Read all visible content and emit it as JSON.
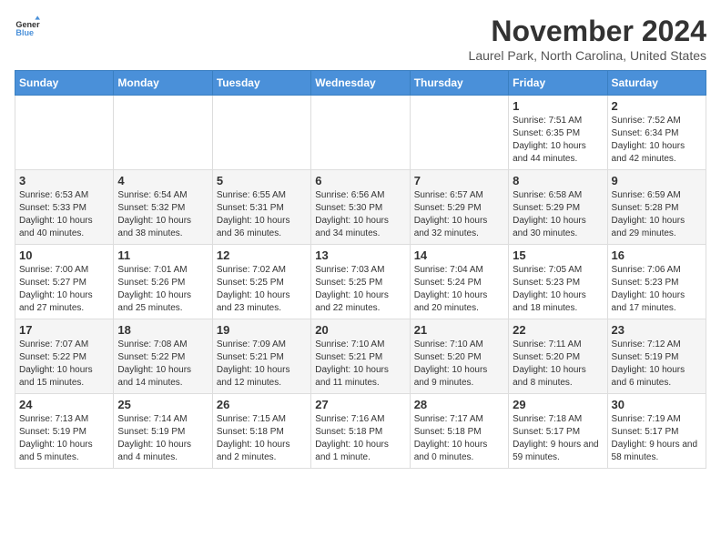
{
  "header": {
    "logo_general": "General",
    "logo_blue": "Blue",
    "month_title": "November 2024",
    "location": "Laurel Park, North Carolina, United States"
  },
  "days_of_week": [
    "Sunday",
    "Monday",
    "Tuesday",
    "Wednesday",
    "Thursday",
    "Friday",
    "Saturday"
  ],
  "weeks": [
    [
      {
        "day": "",
        "info": ""
      },
      {
        "day": "",
        "info": ""
      },
      {
        "day": "",
        "info": ""
      },
      {
        "day": "",
        "info": ""
      },
      {
        "day": "",
        "info": ""
      },
      {
        "day": "1",
        "info": "Sunrise: 7:51 AM\nSunset: 6:35 PM\nDaylight: 10 hours and 44 minutes."
      },
      {
        "day": "2",
        "info": "Sunrise: 7:52 AM\nSunset: 6:34 PM\nDaylight: 10 hours and 42 minutes."
      }
    ],
    [
      {
        "day": "3",
        "info": "Sunrise: 6:53 AM\nSunset: 5:33 PM\nDaylight: 10 hours and 40 minutes."
      },
      {
        "day": "4",
        "info": "Sunrise: 6:54 AM\nSunset: 5:32 PM\nDaylight: 10 hours and 38 minutes."
      },
      {
        "day": "5",
        "info": "Sunrise: 6:55 AM\nSunset: 5:31 PM\nDaylight: 10 hours and 36 minutes."
      },
      {
        "day": "6",
        "info": "Sunrise: 6:56 AM\nSunset: 5:30 PM\nDaylight: 10 hours and 34 minutes."
      },
      {
        "day": "7",
        "info": "Sunrise: 6:57 AM\nSunset: 5:29 PM\nDaylight: 10 hours and 32 minutes."
      },
      {
        "day": "8",
        "info": "Sunrise: 6:58 AM\nSunset: 5:29 PM\nDaylight: 10 hours and 30 minutes."
      },
      {
        "day": "9",
        "info": "Sunrise: 6:59 AM\nSunset: 5:28 PM\nDaylight: 10 hours and 29 minutes."
      }
    ],
    [
      {
        "day": "10",
        "info": "Sunrise: 7:00 AM\nSunset: 5:27 PM\nDaylight: 10 hours and 27 minutes."
      },
      {
        "day": "11",
        "info": "Sunrise: 7:01 AM\nSunset: 5:26 PM\nDaylight: 10 hours and 25 minutes."
      },
      {
        "day": "12",
        "info": "Sunrise: 7:02 AM\nSunset: 5:25 PM\nDaylight: 10 hours and 23 minutes."
      },
      {
        "day": "13",
        "info": "Sunrise: 7:03 AM\nSunset: 5:25 PM\nDaylight: 10 hours and 22 minutes."
      },
      {
        "day": "14",
        "info": "Sunrise: 7:04 AM\nSunset: 5:24 PM\nDaylight: 10 hours and 20 minutes."
      },
      {
        "day": "15",
        "info": "Sunrise: 7:05 AM\nSunset: 5:23 PM\nDaylight: 10 hours and 18 minutes."
      },
      {
        "day": "16",
        "info": "Sunrise: 7:06 AM\nSunset: 5:23 PM\nDaylight: 10 hours and 17 minutes."
      }
    ],
    [
      {
        "day": "17",
        "info": "Sunrise: 7:07 AM\nSunset: 5:22 PM\nDaylight: 10 hours and 15 minutes."
      },
      {
        "day": "18",
        "info": "Sunrise: 7:08 AM\nSunset: 5:22 PM\nDaylight: 10 hours and 14 minutes."
      },
      {
        "day": "19",
        "info": "Sunrise: 7:09 AM\nSunset: 5:21 PM\nDaylight: 10 hours and 12 minutes."
      },
      {
        "day": "20",
        "info": "Sunrise: 7:10 AM\nSunset: 5:21 PM\nDaylight: 10 hours and 11 minutes."
      },
      {
        "day": "21",
        "info": "Sunrise: 7:10 AM\nSunset: 5:20 PM\nDaylight: 10 hours and 9 minutes."
      },
      {
        "day": "22",
        "info": "Sunrise: 7:11 AM\nSunset: 5:20 PM\nDaylight: 10 hours and 8 minutes."
      },
      {
        "day": "23",
        "info": "Sunrise: 7:12 AM\nSunset: 5:19 PM\nDaylight: 10 hours and 6 minutes."
      }
    ],
    [
      {
        "day": "24",
        "info": "Sunrise: 7:13 AM\nSunset: 5:19 PM\nDaylight: 10 hours and 5 minutes."
      },
      {
        "day": "25",
        "info": "Sunrise: 7:14 AM\nSunset: 5:19 PM\nDaylight: 10 hours and 4 minutes."
      },
      {
        "day": "26",
        "info": "Sunrise: 7:15 AM\nSunset: 5:18 PM\nDaylight: 10 hours and 2 minutes."
      },
      {
        "day": "27",
        "info": "Sunrise: 7:16 AM\nSunset: 5:18 PM\nDaylight: 10 hours and 1 minute."
      },
      {
        "day": "28",
        "info": "Sunrise: 7:17 AM\nSunset: 5:18 PM\nDaylight: 10 hours and 0 minutes."
      },
      {
        "day": "29",
        "info": "Sunrise: 7:18 AM\nSunset: 5:17 PM\nDaylight: 9 hours and 59 minutes."
      },
      {
        "day": "30",
        "info": "Sunrise: 7:19 AM\nSunset: 5:17 PM\nDaylight: 9 hours and 58 minutes."
      }
    ]
  ]
}
